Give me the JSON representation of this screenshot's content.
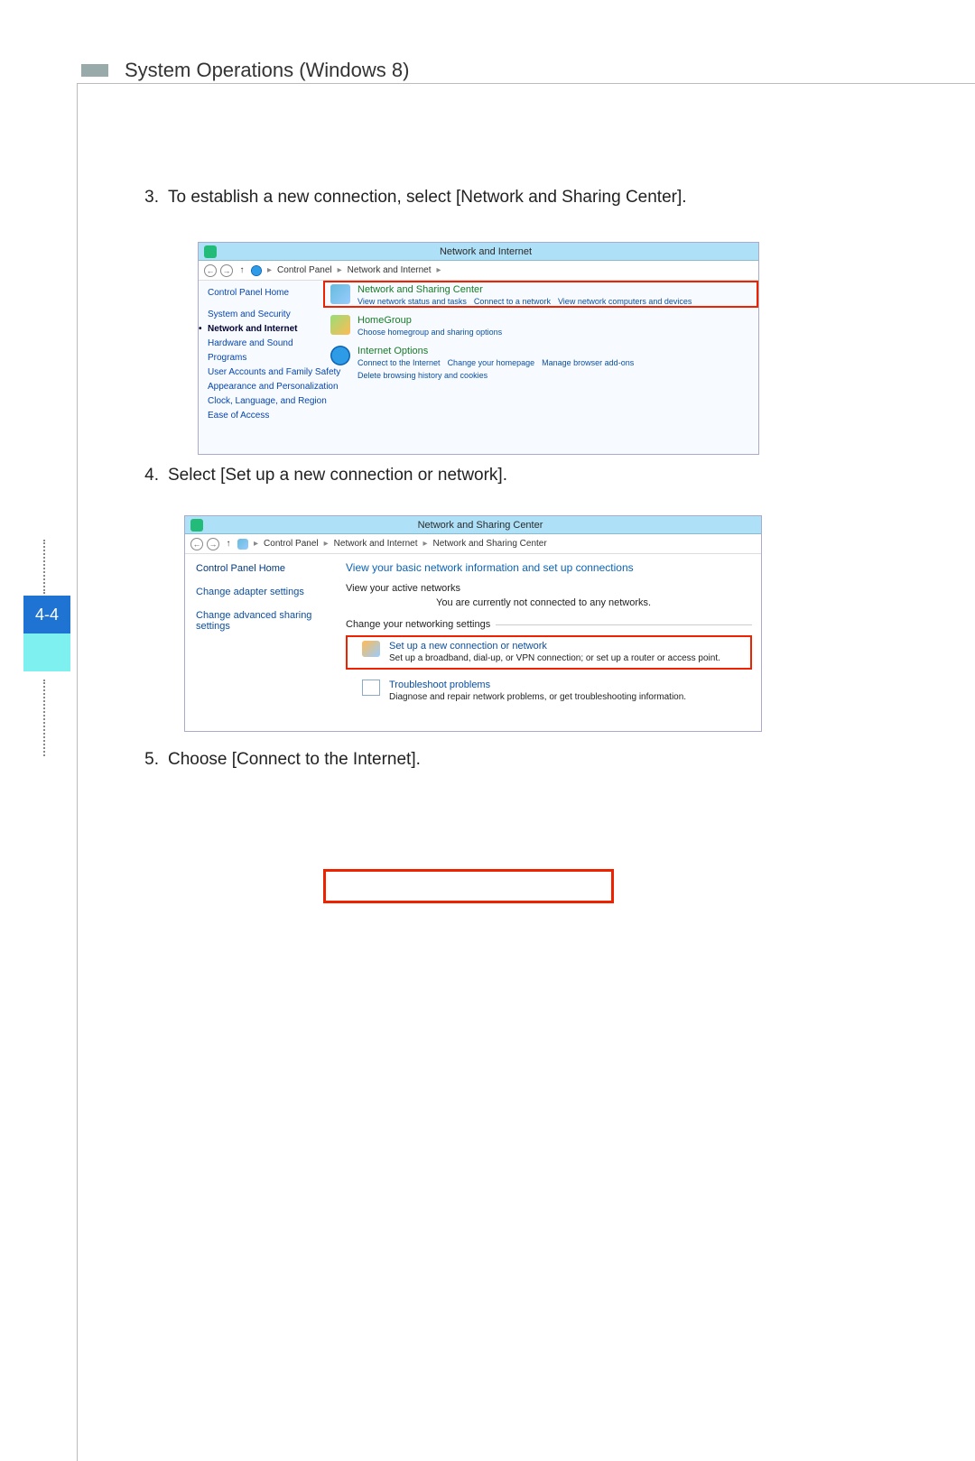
{
  "header": {
    "title": "System Operations (Windows 8)"
  },
  "page_number": "4-4",
  "steps": {
    "s3": {
      "num": "3.",
      "text": "To establish a new connection, select [Network and Sharing Center]."
    },
    "s4": {
      "num": "4.",
      "text": "Select [Set up a new connection or network]."
    },
    "s5": {
      "num": "5.",
      "text": "Choose [Connect to the Internet]."
    }
  },
  "shot1": {
    "window_title": "Network and Internet",
    "breadcrumb": {
      "root": "Control Panel",
      "level1": "Network and Internet"
    },
    "sidebar": {
      "home": "Control Panel Home",
      "items": [
        "System and Security",
        "Network and Internet",
        "Hardware and Sound",
        "Programs",
        "User Accounts and Family Safety",
        "Appearance and Personalization",
        "Clock, Language, and Region",
        "Ease of Access"
      ]
    },
    "categories": [
      {
        "title": "Network and Sharing Center",
        "links": [
          "View network status and tasks",
          "Connect to a network",
          "View network computers and devices"
        ]
      },
      {
        "title": "HomeGroup",
        "links": [
          "Choose homegroup and sharing options"
        ]
      },
      {
        "title": "Internet Options",
        "links": [
          "Connect to the Internet",
          "Change your homepage",
          "Manage browser add-ons",
          "Delete browsing history and cookies"
        ]
      }
    ]
  },
  "shot2": {
    "window_title": "Network and Sharing Center",
    "breadcrumb": {
      "root": "Control Panel",
      "level1": "Network and Internet",
      "level2": "Network and Sharing Center"
    },
    "sidebar": {
      "home": "Control Panel Home",
      "links": [
        "Change adapter settings",
        "Change advanced sharing settings"
      ]
    },
    "main": {
      "heading": "View your basic network information and set up connections",
      "active_label": "View your active networks",
      "not_connected": "You are currently not connected to any networks.",
      "change_label": "Change your networking settings",
      "options": [
        {
          "title": "Set up a new connection or network",
          "desc": "Set up a broadband, dial-up, or VPN connection; or set up a router or access point."
        },
        {
          "title": "Troubleshoot problems",
          "desc": "Diagnose and repair network problems, or get troubleshooting information."
        }
      ]
    }
  }
}
